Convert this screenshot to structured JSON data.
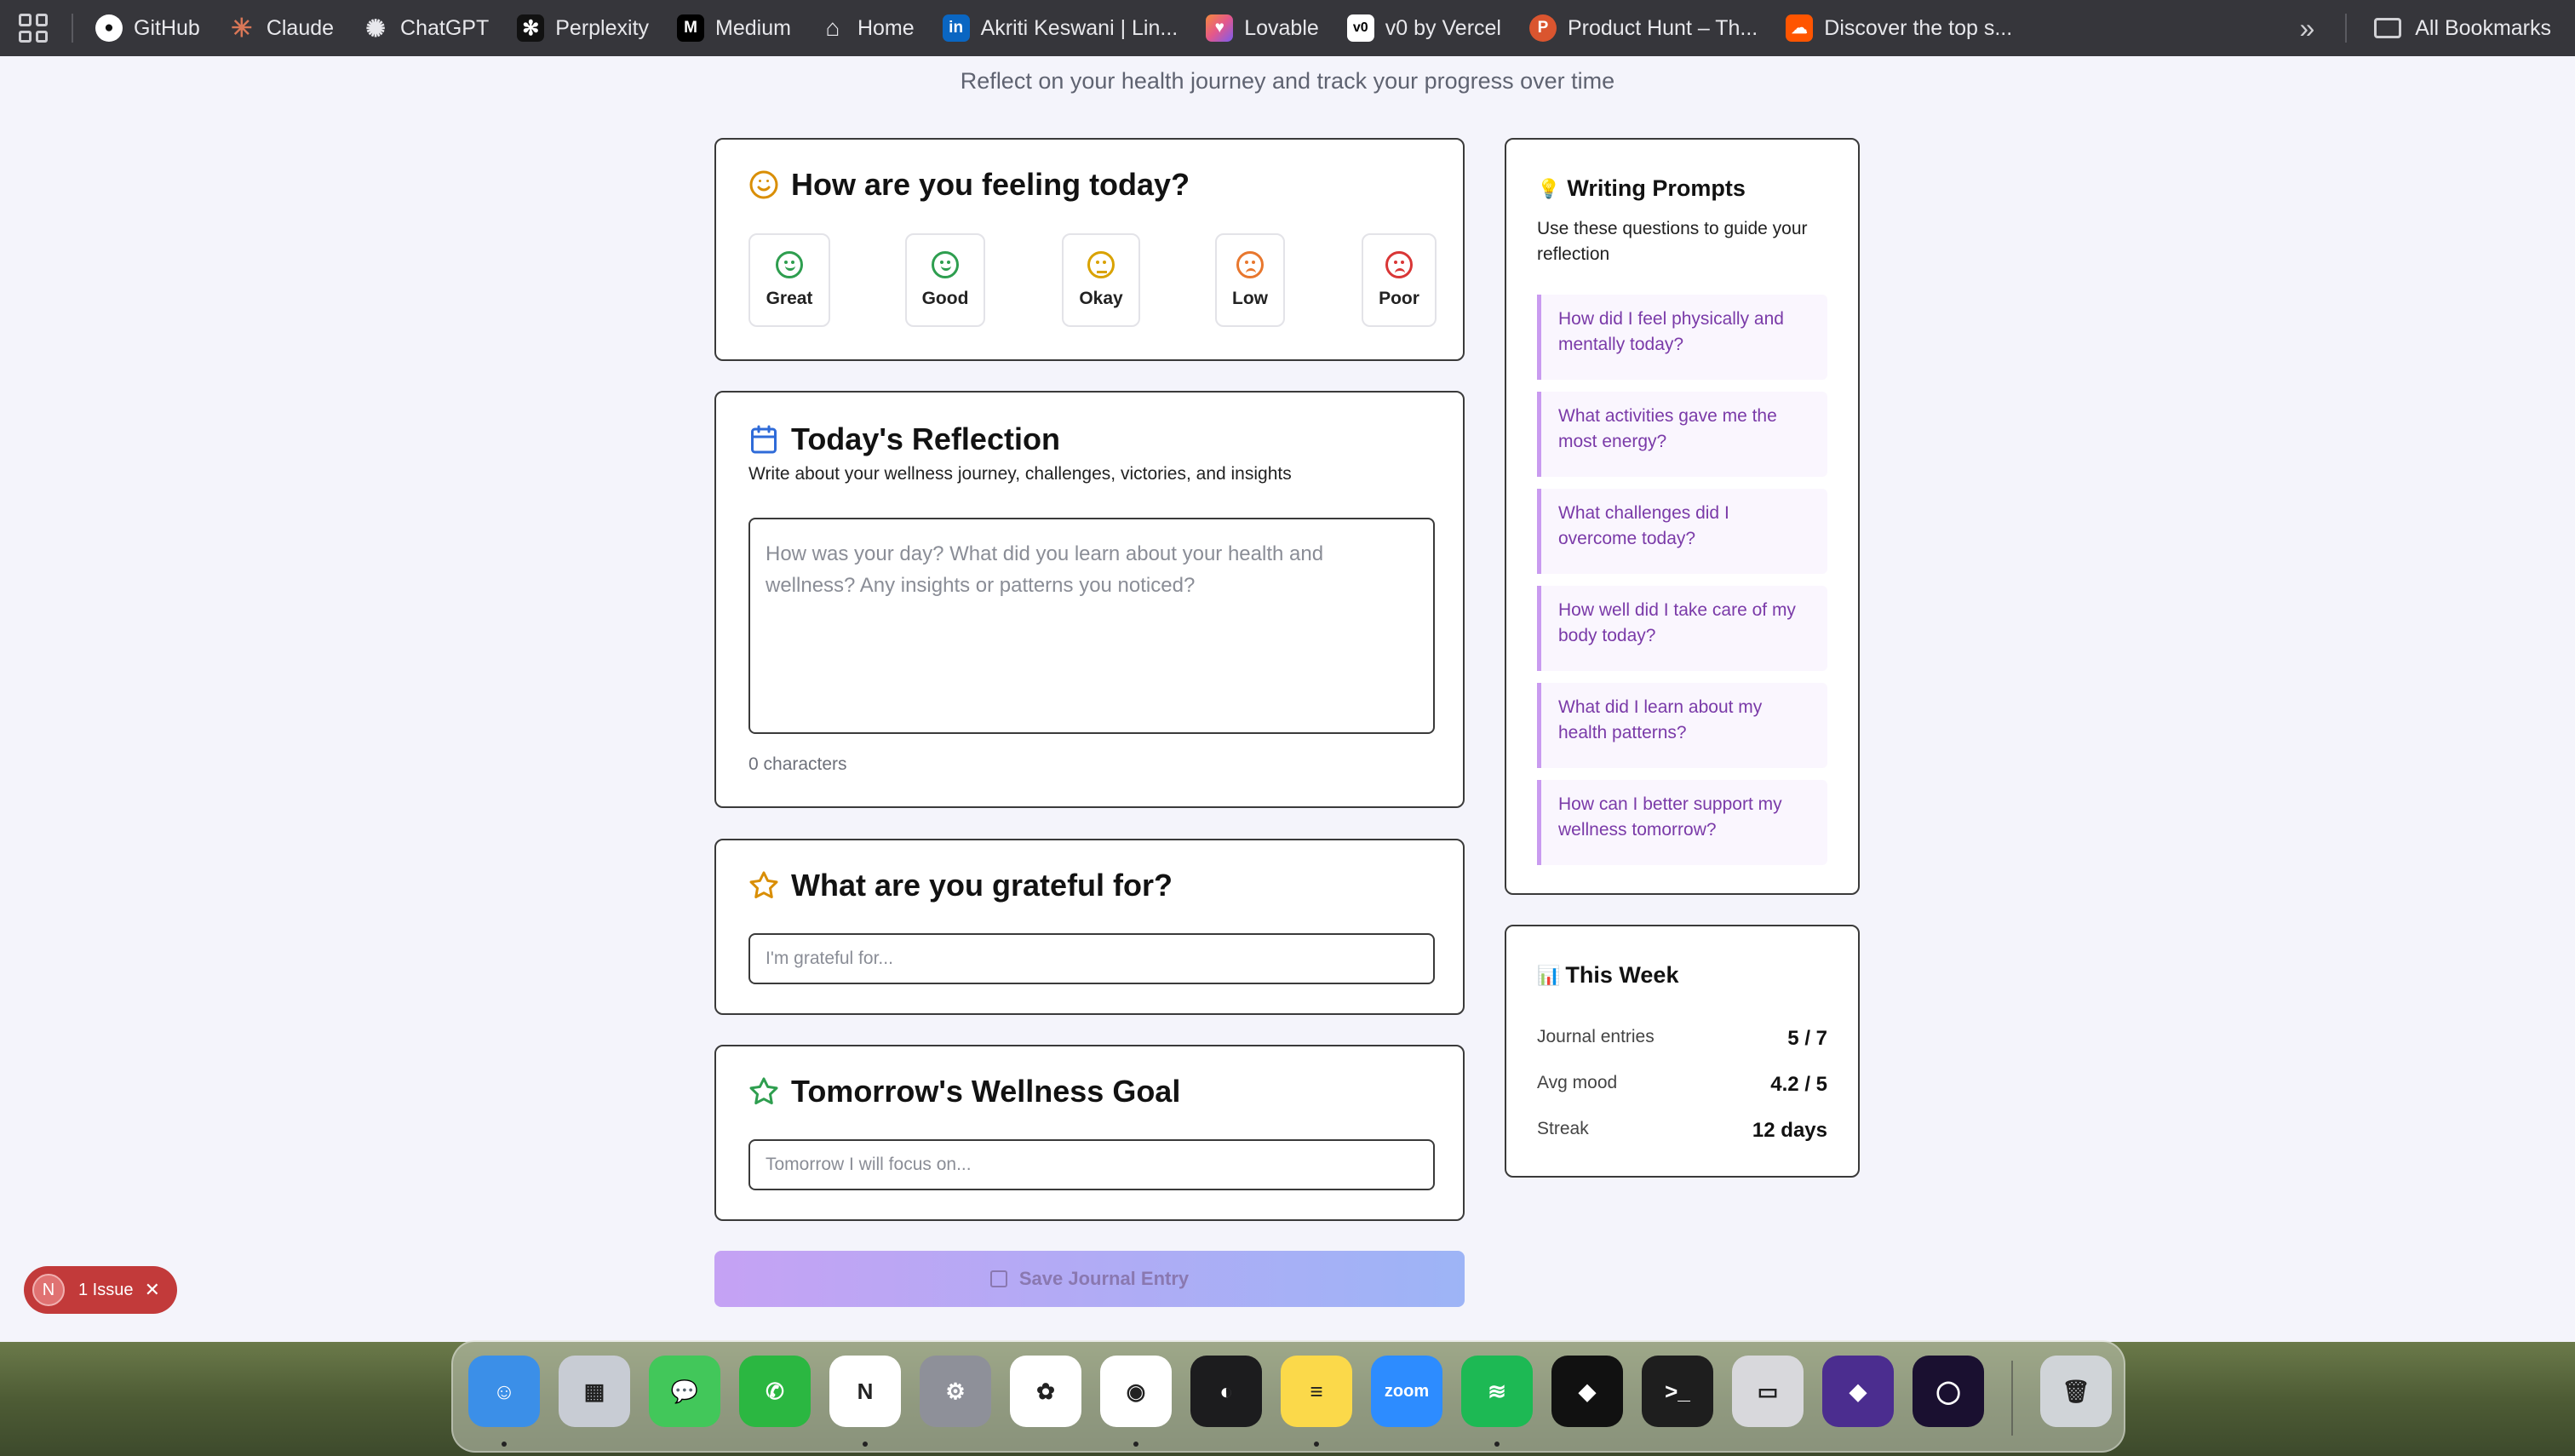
{
  "bookmarks": {
    "items": [
      {
        "label": "GitHub",
        "icon": "github-icon",
        "color": "#ffffff"
      },
      {
        "label": "Claude",
        "icon": "claude-icon",
        "color": "#d97757"
      },
      {
        "label": "ChatGPT",
        "icon": "chatgpt-icon",
        "color": "#e8e8ec"
      },
      {
        "label": "Perplexity",
        "icon": "perplexity-icon",
        "color": "#e8e8ec"
      },
      {
        "label": "Medium",
        "icon": "medium-icon",
        "color": "#000000"
      },
      {
        "label": "Home",
        "icon": "home-icon",
        "color": "#e8e8ec"
      },
      {
        "label": "Akriti Keswani | Lin...",
        "icon": "linkedin-icon",
        "color": "#0a66c2"
      },
      {
        "label": "Lovable",
        "icon": "lovable-icon",
        "color": "#e4578b"
      },
      {
        "label": "v0 by Vercel",
        "icon": "v0-icon",
        "color": "#ffffff"
      },
      {
        "label": "Product Hunt – Th...",
        "icon": "producthunt-icon",
        "color": "#da552f"
      },
      {
        "label": "Discover the top s...",
        "icon": "soundcloud-icon",
        "color": "#ff5500"
      }
    ],
    "all_bookmarks": "All Bookmarks"
  },
  "header": {
    "subtitle": "Reflect on your health journey and track your progress over time"
  },
  "mood": {
    "title": "How are you feeling today?",
    "options": [
      {
        "label": "Great",
        "color": "#2e9e4f",
        "face": "smile"
      },
      {
        "label": "Good",
        "color": "#2e9e4f",
        "face": "smile"
      },
      {
        "label": "Okay",
        "color": "#d9a200",
        "face": "flat"
      },
      {
        "label": "Low",
        "color": "#e8772e",
        "face": "frown"
      },
      {
        "label": "Poor",
        "color": "#d93636",
        "face": "frown"
      }
    ]
  },
  "reflection": {
    "title": "Today's Reflection",
    "description": "Write about your wellness journey, challenges, victories, and insights",
    "placeholder": "How was your day? What did you learn about your health and wellness? Any insights or patterns you noticed?",
    "char_count": "0 characters"
  },
  "gratitude": {
    "title": "What are you grateful for?",
    "placeholder": "I'm grateful for..."
  },
  "goal": {
    "title": "Tomorrow's Wellness Goal",
    "placeholder": "Tomorrow I will focus on..."
  },
  "save_label": "Save Journal Entry",
  "prompts": {
    "title": "Writing Prompts",
    "icon": "💡",
    "subtitle": "Use these questions to guide your reflection",
    "items": [
      "How did I feel physically and mentally today?",
      "What activities gave me the most energy?",
      "What challenges did I overcome today?",
      "How well did I take care of my body today?",
      "What did I learn about my health patterns?",
      "How can I better support my wellness tomorrow?"
    ]
  },
  "week": {
    "title": "This Week",
    "icon": "📊",
    "stats": [
      {
        "label": "Journal entries",
        "value": "5 / 7"
      },
      {
        "label": "Avg mood",
        "value": "4.2 / 5"
      },
      {
        "label": "Streak",
        "value": "12 days"
      }
    ]
  },
  "issue_badge": {
    "initial": "N",
    "label": "1 Issue",
    "close": "✕"
  },
  "dock": {
    "apps": [
      {
        "name": "finder-icon",
        "color": "#3b8fe8",
        "glyph": "☺"
      },
      {
        "name": "launchpad-icon",
        "color": "#c8ccd4",
        "glyph": "▦"
      },
      {
        "name": "messages-icon",
        "color": "#42c75a",
        "glyph": "💬"
      },
      {
        "name": "whatsapp-icon",
        "color": "#2bb741",
        "glyph": "✆"
      },
      {
        "name": "notion-icon",
        "color": "#ffffff",
        "glyph": "N"
      },
      {
        "name": "system-settings-icon",
        "color": "#8e9099",
        "glyph": "⚙"
      },
      {
        "name": "photos-icon",
        "color": "#ffffff",
        "glyph": "✿"
      },
      {
        "name": "chrome-icon",
        "color": "#ffffff",
        "glyph": "◉"
      },
      {
        "name": "app-icon",
        "color": "#1c1c1e",
        "glyph": "◐"
      },
      {
        "name": "notes-icon",
        "color": "#fbd94a",
        "glyph": "≡"
      },
      {
        "name": "zoom-icon",
        "color": "#2d8cff",
        "glyph": "zoom"
      },
      {
        "name": "spotify-icon",
        "color": "#1db954",
        "glyph": "≋"
      },
      {
        "name": "cube-app-icon",
        "color": "#111111",
        "glyph": "◆"
      },
      {
        "name": "terminal-icon",
        "color": "#1e1e1e",
        "glyph": ">_"
      },
      {
        "name": "app-icon-2",
        "color": "#d8d8dc",
        "glyph": "▭"
      },
      {
        "name": "obsidian-icon",
        "color": "#4b2d8f",
        "glyph": "◆"
      },
      {
        "name": "app-icon-3",
        "color": "#1a1030",
        "glyph": "◯"
      },
      {
        "name": "trash-icon",
        "color": "#d0d4d8",
        "glyph": "🗑"
      }
    ]
  }
}
